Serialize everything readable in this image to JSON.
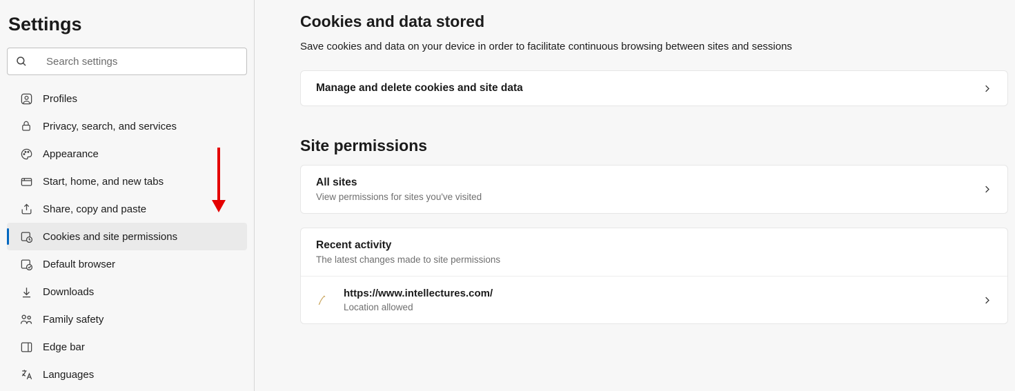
{
  "sidebar": {
    "title": "Settings",
    "search_placeholder": "Search settings",
    "items": [
      {
        "label": "Profiles"
      },
      {
        "label": "Privacy, search, and services"
      },
      {
        "label": "Appearance"
      },
      {
        "label": "Start, home, and new tabs"
      },
      {
        "label": "Share, copy and paste"
      },
      {
        "label": "Cookies and site permissions"
      },
      {
        "label": "Default browser"
      },
      {
        "label": "Downloads"
      },
      {
        "label": "Family safety"
      },
      {
        "label": "Edge bar"
      },
      {
        "label": "Languages"
      }
    ]
  },
  "cookies_section": {
    "title": "Cookies and data stored",
    "desc": "Save cookies and data on your device in order to facilitate continuous browsing between sites and sessions",
    "manage_row": "Manage and delete cookies and site data"
  },
  "permissions_section": {
    "title": "Site permissions",
    "all_sites": {
      "title": "All sites",
      "sub": "View permissions for sites you've visited"
    },
    "recent": {
      "title": "Recent activity",
      "sub": "The latest changes made to site permissions",
      "site": {
        "url": "https://www.intellectures.com/",
        "status": "Location allowed"
      }
    }
  }
}
